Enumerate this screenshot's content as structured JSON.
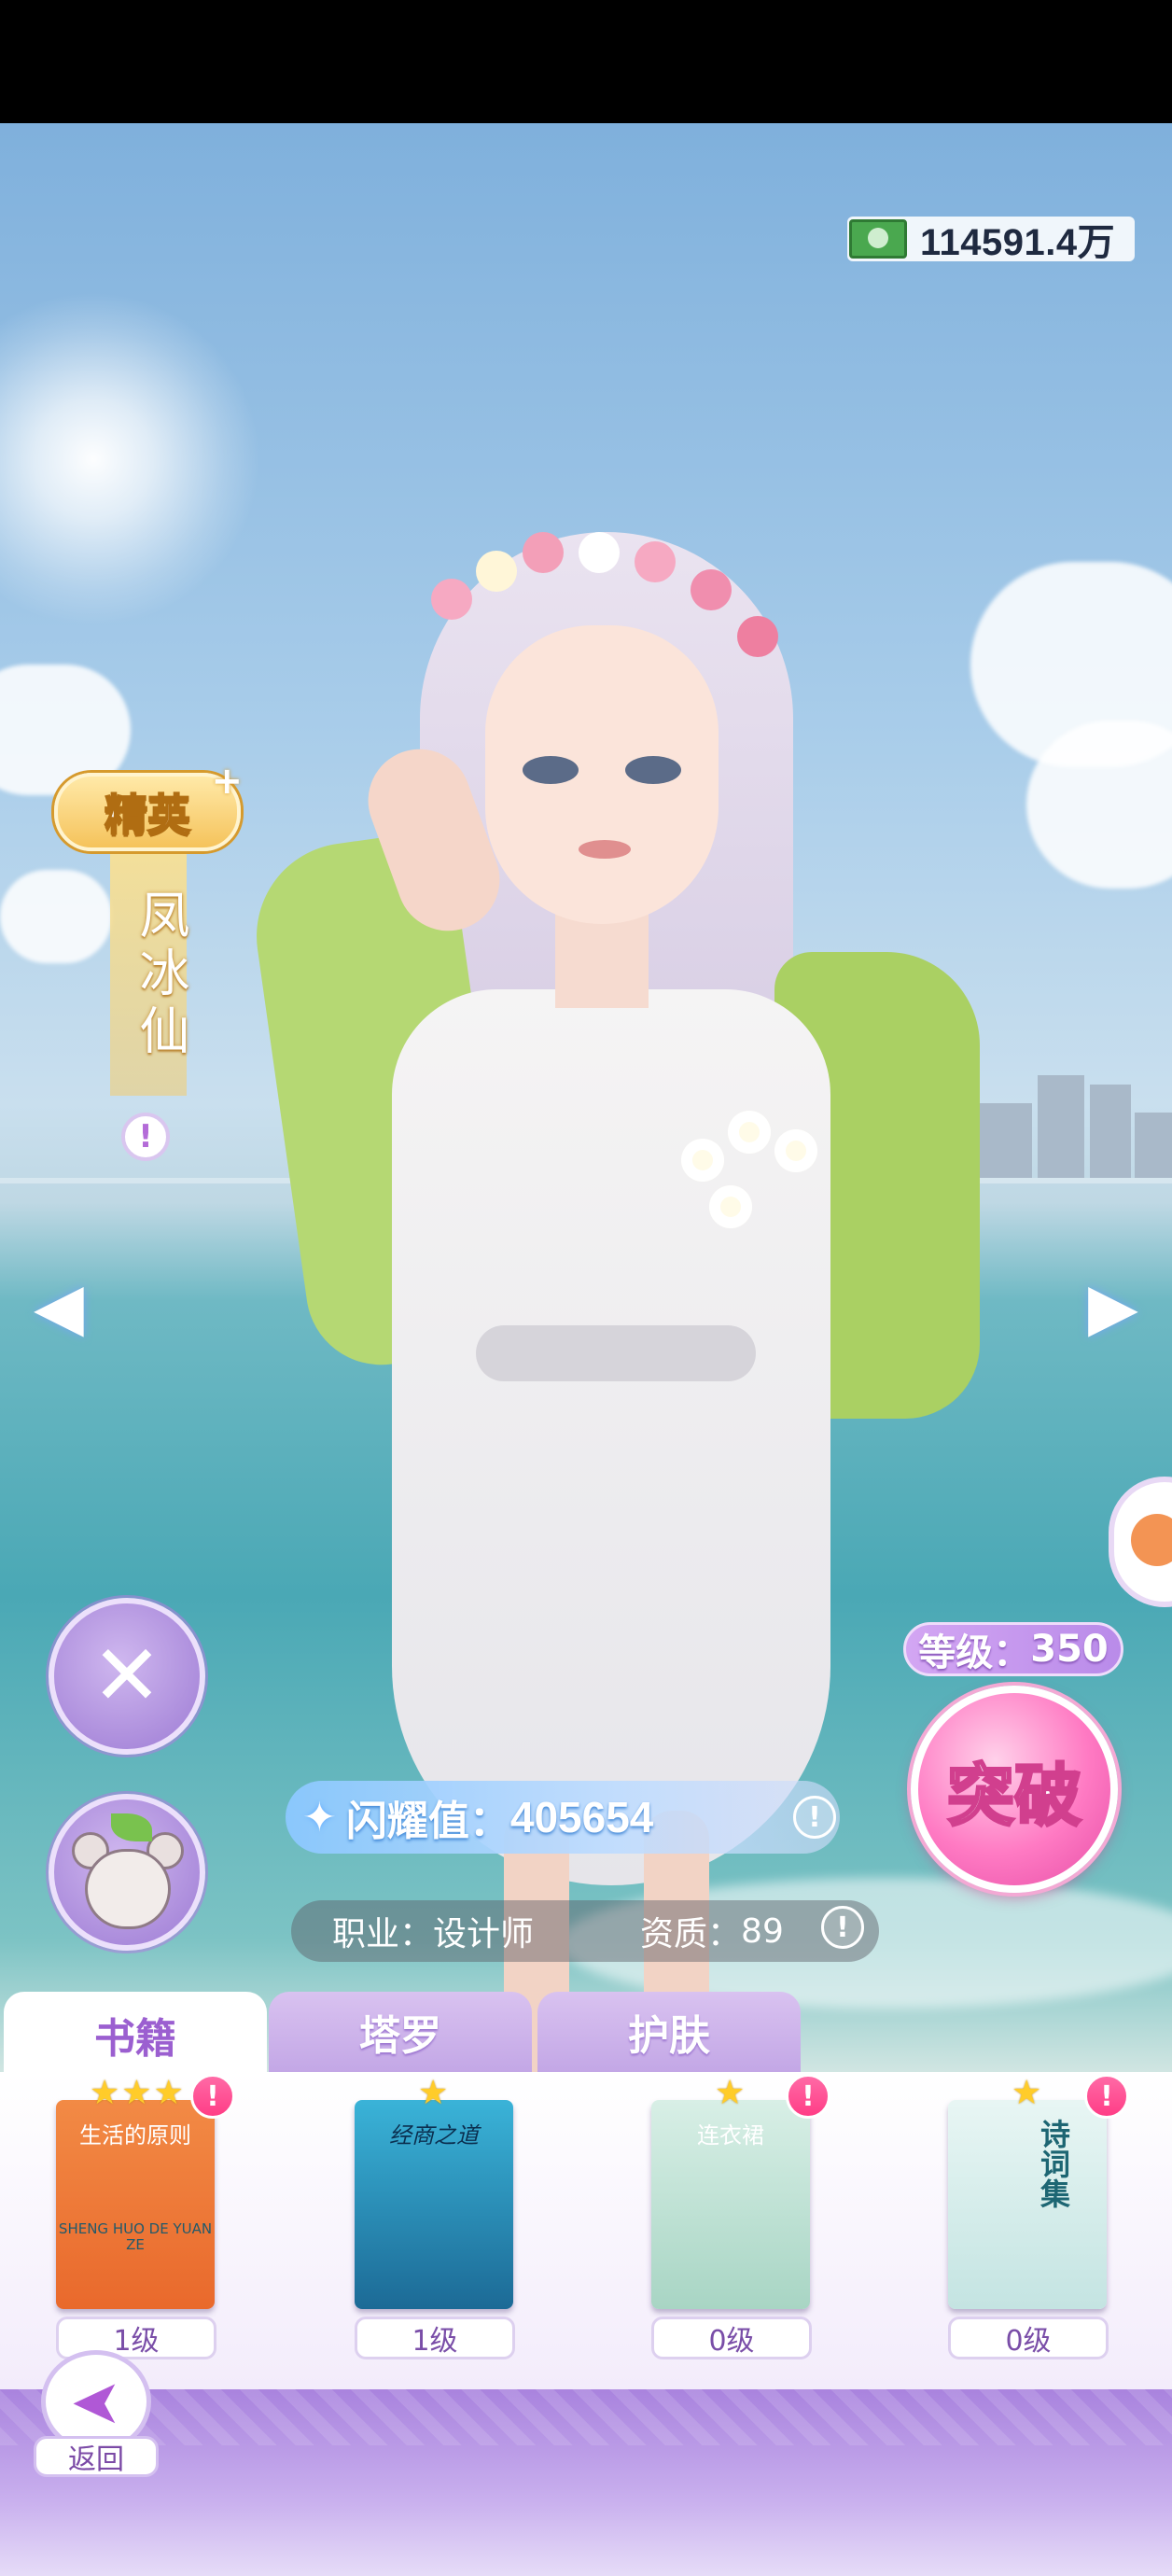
{
  "currency": {
    "value": "114591.4万",
    "icon": "cash-icon"
  },
  "character": {
    "rank": "精英",
    "rank_plus": "+",
    "name": "凤冰仙",
    "level_label": "等级：",
    "level_value": "350",
    "shine_label": "闪耀值：",
    "shine_value": "405654",
    "job_label": "职业：",
    "job_value": "设计师",
    "aptitude_label": "资质：",
    "aptitude_value": "89"
  },
  "actions": {
    "breakthrough": "突破",
    "back": "返回",
    "info_mark": "!",
    "prev_arrow": "◀",
    "next_arrow": "▶"
  },
  "tabs": [
    {
      "label": "书籍",
      "active": true
    },
    {
      "label": "塔罗",
      "active": false
    },
    {
      "label": "护肤",
      "active": false
    }
  ],
  "books": [
    {
      "title": "生活的原则",
      "subtitle": "SHENG HUO DE YUAN ZE",
      "stars": 3,
      "level": "1级",
      "alert": true,
      "color": "#f07a3a"
    },
    {
      "title": "经商之道",
      "subtitle": "",
      "stars": 1,
      "level": "1级",
      "alert": false,
      "color": "#2f8db4"
    },
    {
      "title": "连衣裙",
      "subtitle": "",
      "stars": 1,
      "level": "0级",
      "alert": true,
      "color": "#c6e3d8"
    },
    {
      "title": "诗词集",
      "subtitle": "",
      "stars": 1,
      "level": "0级",
      "alert": true,
      "color": "#dcefee"
    }
  ],
  "colors": {
    "accent": "#b46bd8",
    "pink": "#ff5ea7",
    "gold": "#f5c35b"
  }
}
